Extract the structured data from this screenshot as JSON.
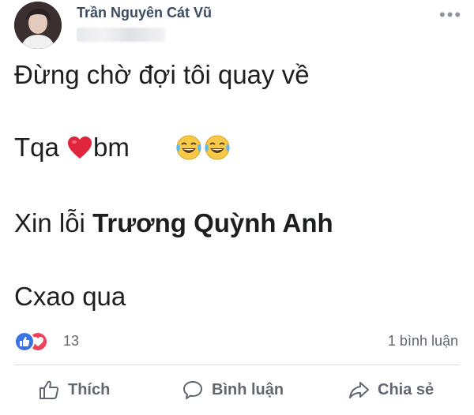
{
  "post": {
    "author": "Trần Nguyên Cát Vũ",
    "more_label": "•••",
    "lines": {
      "line1": "Đừng chờ đợi tôi quay về",
      "line2_a": "Tqa ",
      "line2_b": "bm",
      "line3_a": "Xin lỗi ",
      "line3_mention": "Trương Quỳnh Anh",
      "line4": "Cxao qua"
    },
    "emojis": [
      "heart-emoji",
      "laughing-tears-emoji",
      "laughing-tears-emoji"
    ]
  },
  "stats": {
    "reaction_count": "13",
    "comments": "1 bình luận"
  },
  "actions": {
    "like": "Thích",
    "comment": "Bình luận",
    "share": "Chia sẻ"
  },
  "colors": {
    "author": "#3b4b62",
    "like_reaction": "#3b73e4",
    "love_reaction": "#f0405a",
    "action_text": "#606770"
  }
}
